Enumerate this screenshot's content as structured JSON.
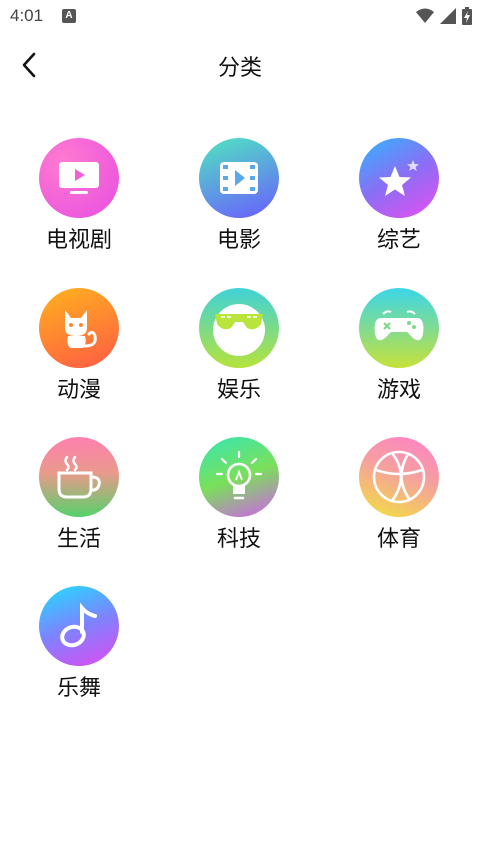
{
  "status_bar": {
    "time": "4:01",
    "notification_glyph": "A",
    "icons": [
      "wifi-icon",
      "signal-icon",
      "battery-charging-icon"
    ]
  },
  "header": {
    "back_icon": "chevron-left-icon",
    "title": "分类"
  },
  "categories": [
    {
      "label": "电视剧",
      "icon": "tv-icon",
      "gradient": [
        "#ff5ec4",
        "#e84fe0"
      ]
    },
    {
      "label": "电影",
      "icon": "film-icon",
      "gradient": [
        "#4fe6c0",
        "#6a5cff"
      ]
    },
    {
      "label": "综艺",
      "icon": "star-icon",
      "gradient": [
        "#2fb6ff",
        "#e94ef0"
      ]
    },
    {
      "label": "动漫",
      "icon": "cat-icon",
      "gradient": [
        "#ffb21e",
        "#ff5b44"
      ]
    },
    {
      "label": "娱乐",
      "icon": "sunglasses-icon",
      "gradient": [
        "#3fd2d8",
        "#b6e33a"
      ]
    },
    {
      "label": "游戏",
      "icon": "gamepad-icon",
      "gradient": [
        "#3bd6e8",
        "#c6e13a"
      ]
    },
    {
      "label": "生活",
      "icon": "coffee-cup-icon",
      "gradient": [
        "#ff7fb0",
        "#55d16a"
      ]
    },
    {
      "label": "科技",
      "icon": "lightbulb-icon",
      "gradient": [
        "#36e6b4",
        "#d45cf0"
      ]
    },
    {
      "label": "体育",
      "icon": "basketball-icon",
      "gradient": [
        "#ff7fc8",
        "#f2e23a"
      ]
    },
    {
      "label": "乐舞",
      "icon": "music-note-icon",
      "gradient": [
        "#1ee0ff",
        "#e04af0"
      ]
    }
  ]
}
